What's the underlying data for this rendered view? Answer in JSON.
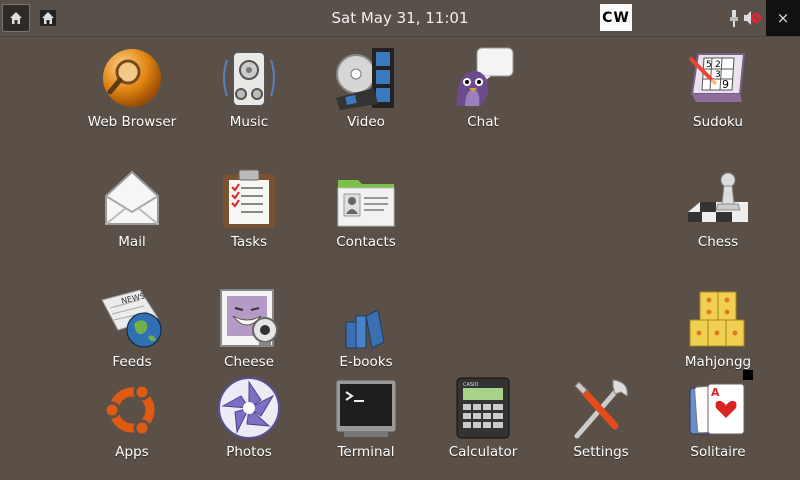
{
  "topbar": {
    "clock": "Sat May 31, 11:01",
    "logo_text": "CW",
    "close_label": "×"
  },
  "apps": [
    {
      "id": "web-browser",
      "label": "Web Browser"
    },
    {
      "id": "music",
      "label": "Music"
    },
    {
      "id": "video",
      "label": "Video"
    },
    {
      "id": "chat",
      "label": "Chat"
    },
    {
      "id": "sudoku",
      "label": "Sudoku"
    },
    {
      "id": "mail",
      "label": "Mail"
    },
    {
      "id": "tasks",
      "label": "Tasks"
    },
    {
      "id": "contacts",
      "label": "Contacts"
    },
    {
      "id": "chess",
      "label": "Chess"
    },
    {
      "id": "feeds",
      "label": "Feeds"
    },
    {
      "id": "cheese",
      "label": "Cheese"
    },
    {
      "id": "e-books",
      "label": "E-books"
    },
    {
      "id": "mahjongg",
      "label": "Mahjongg"
    },
    {
      "id": "apps",
      "label": "Apps"
    },
    {
      "id": "photos",
      "label": "Photos"
    },
    {
      "id": "terminal",
      "label": "Terminal"
    },
    {
      "id": "calculator",
      "label": "Calculator"
    },
    {
      "id": "settings",
      "label": "Settings"
    },
    {
      "id": "solitaire",
      "label": "Solitaire"
    }
  ],
  "sudoku_digits": [
    "5",
    "2",
    "3",
    "9"
  ],
  "feeds_badge": "NEWS",
  "calculator_brand": "CASIO",
  "solitaire_card": "A",
  "icons": {
    "home": "home-icon",
    "usb": "usb-icon",
    "mute": "volume-muted-icon",
    "close": "close-icon"
  },
  "colors": {
    "background": "#5b5047",
    "topbar": "#59504a"
  }
}
